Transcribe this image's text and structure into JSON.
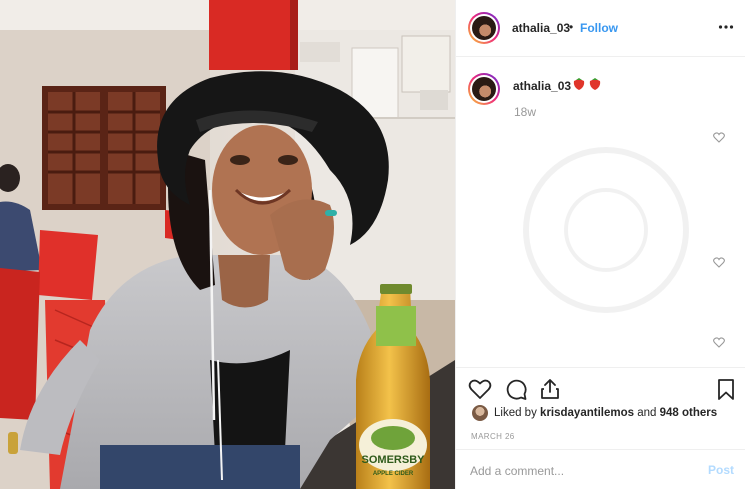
{
  "post": {
    "username": "athalia_03",
    "separator": "•",
    "follow_label": "Follow",
    "caption_username": "athalia_03",
    "caption_emoji": "🍓🍓",
    "time_ago": "18w",
    "likes_prefix": "Liked by",
    "likes_user": "krisdayantilemos",
    "likes_and": "and",
    "likes_count": "948 others",
    "date": "MARCH 26",
    "comment_placeholder": "Add a comment...",
    "post_label": "Post",
    "bottle_label": "SOMERSBY",
    "bottle_sublabel": "APPLE CIDER"
  },
  "colors": {
    "link_blue": "#3897f0",
    "post_disabled": "#b3dbff",
    "wall_red": "#d92a24"
  },
  "icons": [
    "more-icon",
    "heart-icon",
    "comment-icon",
    "share-icon",
    "bookmark-icon"
  ]
}
